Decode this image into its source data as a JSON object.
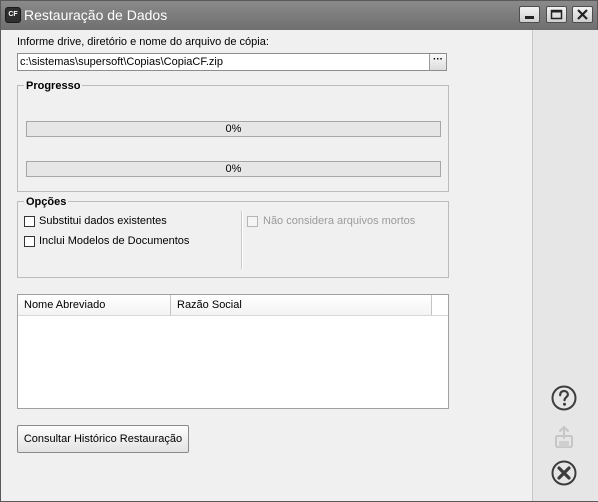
{
  "window": {
    "title": "Restauração de Dados",
    "app_icon_text": "CF"
  },
  "file": {
    "label": "Informe drive, diretório e nome do arquivo de cópia:",
    "path": "c:\\sistemas\\supersoft\\Copias\\CopiaCF.zip",
    "browse_label": "···"
  },
  "progress": {
    "title": "Progresso",
    "bars": [
      {
        "label": "0%",
        "value": 0
      },
      {
        "label": "0%",
        "value": 0
      }
    ]
  },
  "options": {
    "title": "Opções",
    "items": [
      {
        "label": "Substitui dados existentes",
        "checked": false,
        "enabled": true
      },
      {
        "label": "Inclui Modelos de Documentos",
        "checked": false,
        "enabled": true
      },
      {
        "label": "Não considera arquivos mortos",
        "checked": false,
        "enabled": false
      }
    ]
  },
  "table": {
    "columns": [
      "Nome Abreviado",
      "Razão Social"
    ],
    "rows": []
  },
  "buttons": {
    "history": "Consultar Histórico Restauração"
  },
  "side_icons": [
    "help-icon",
    "export-icon",
    "close-icon"
  ],
  "colors": {
    "titlebar": "#777777",
    "progress_fill": "#06b025"
  }
}
